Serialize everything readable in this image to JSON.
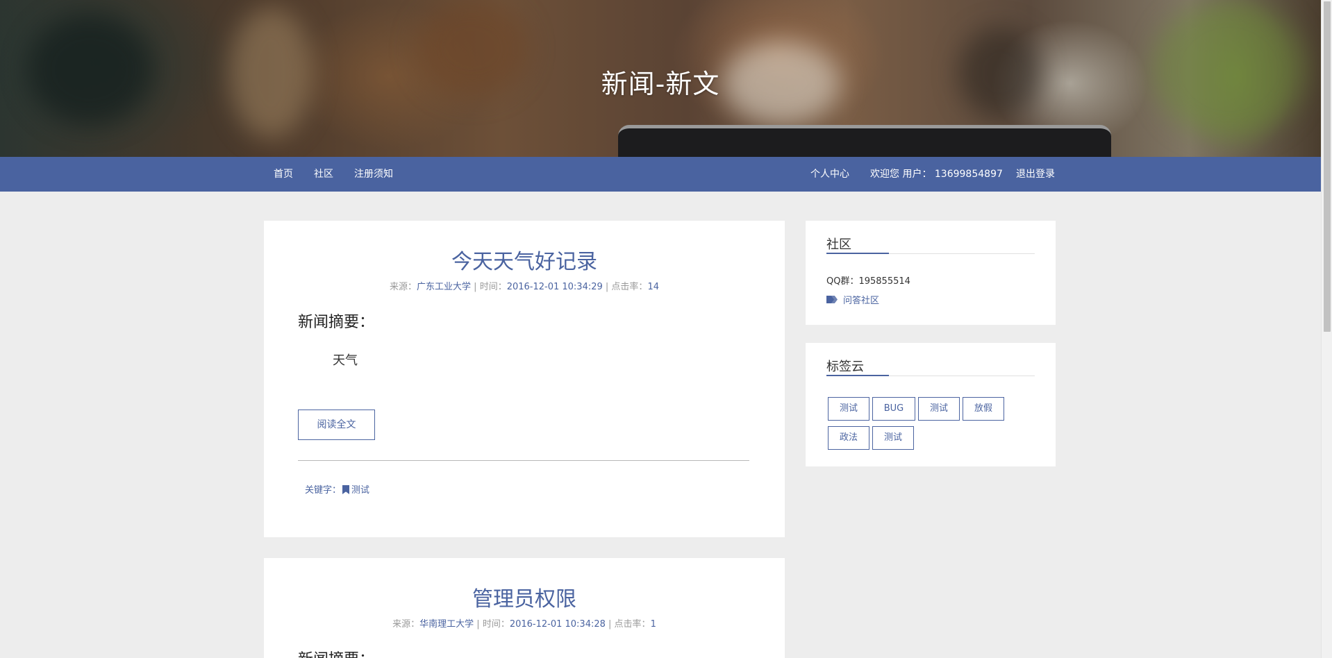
{
  "site": {
    "title": "新闻-新文"
  },
  "nav": {
    "left": [
      "首页",
      "社区",
      "注册须知"
    ],
    "right": [
      "个人中心",
      "欢迎您 用户： 13699854897",
      "退出登录"
    ]
  },
  "articles": [
    {
      "title": "今天天气好记录",
      "source_label": "来源：",
      "source": "广东工业大学",
      "time_label": " | 时间：",
      "time": "2016-12-01 10:34:29",
      "clicks_label": " | 点击率：",
      "clicks": "14",
      "summary_heading": "新闻摘要：",
      "summary": "天气",
      "read_more": "阅读全文",
      "keyword_label": "关键字：",
      "keyword": "测试"
    },
    {
      "title": "管理员权限",
      "source_label": "来源：",
      "source": "华南理工大学",
      "time_label": " | 时间：",
      "time": "2016-12-01 10:34:28",
      "clicks_label": " | 点击率：",
      "clicks": "1",
      "summary_heading": "新闻摘要："
    }
  ],
  "sidebar": {
    "community": {
      "heading": "社区",
      "qq": "QQ群：195855514",
      "link": "问答社区"
    },
    "tag_cloud": {
      "heading": "标签云",
      "tags": [
        "测试",
        "BUG",
        "测试",
        "放假",
        "政法",
        "测试"
      ]
    }
  },
  "colors": {
    "accent": "#4a63a0",
    "background": "#ededed",
    "card": "#ffffff"
  }
}
